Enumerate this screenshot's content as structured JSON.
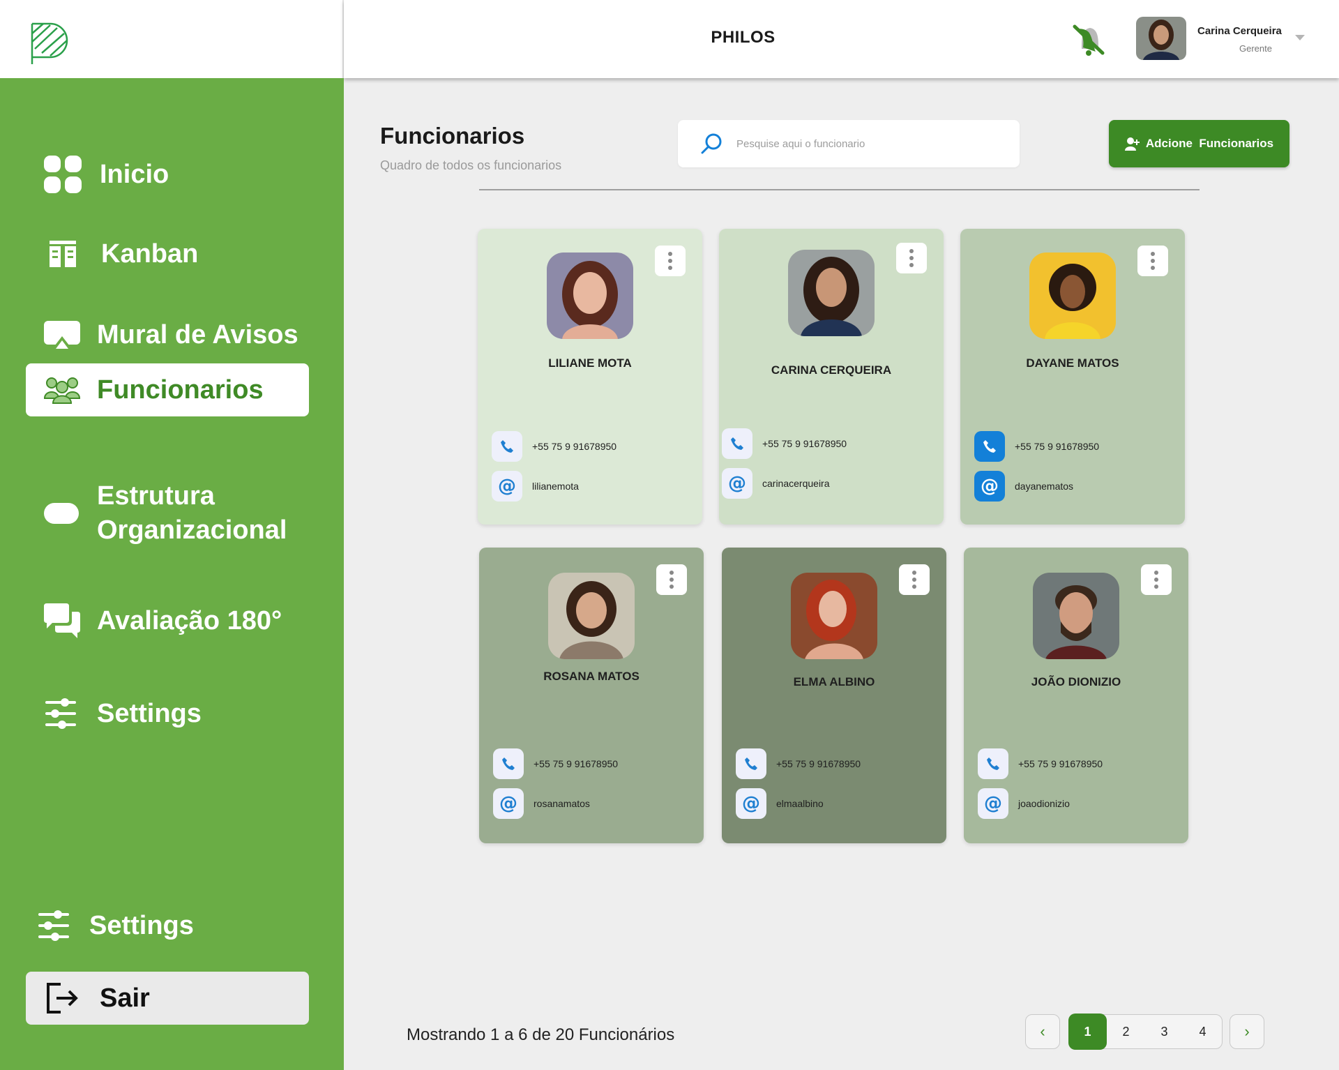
{
  "header": {
    "app_title": "PHILOS",
    "user": {
      "name": "Carina Cerqueira",
      "role": "Gerente"
    }
  },
  "sidebar": {
    "items": [
      {
        "label": "Inicio",
        "icon": "grid-icon"
      },
      {
        "label": "Kanban",
        "icon": "kanban-icon"
      },
      {
        "label": "Mural de Avisos",
        "icon": "notice-board-icon"
      },
      {
        "label": "Funcionarios",
        "icon": "users-icon",
        "active": true
      },
      {
        "label": "Estrutura Organizacional",
        "icon": "pill-icon"
      },
      {
        "label": "Avaliação 180°",
        "icon": "chat-bubbles-icon"
      },
      {
        "label": "Settings",
        "icon": "sliders-icon"
      }
    ],
    "bottom": {
      "settings_label": "Settings",
      "logout_label": "Sair"
    }
  },
  "page": {
    "title": "Funcionarios",
    "subtitle": "Quadro de todos os funcionarios",
    "search_placeholder": "Pesquise aqui o funcionario",
    "add_button": "Adcione  Funcionarios"
  },
  "employees": [
    {
      "name": "LILIANE MOTA",
      "phone": "+55 75 9 91678950",
      "username": "lilianemota",
      "bg": "#dce9d6"
    },
    {
      "name": "CARINA CERQUEIRA",
      "phone": "+55 75 9 91678950",
      "username": "carinacerqueira",
      "bg": "#cfdfc7"
    },
    {
      "name": "DAYANE MATOS",
      "phone": "+55 75 9 91678950",
      "username": "dayanematos",
      "bg": "#b9cbb0"
    },
    {
      "name": "ROSANA MATOS",
      "phone": "+55 75 9 91678950",
      "username": "rosanamatos",
      "bg": "#9aac90"
    },
    {
      "name": "ELMA ALBINO",
      "phone": "+55 75 9 91678950",
      "username": "elmaalbino",
      "bg": "#7b8b71"
    },
    {
      "name": "JOÃO DIONIZIO",
      "phone": "+55 75 9 91678950",
      "username": "joaodionizio",
      "bg": "#a6b99c"
    }
  ],
  "footer": {
    "showing": "Mostrando 1 a 6 de 20 Funcionários",
    "pages": [
      "1",
      "2",
      "3",
      "4"
    ],
    "current_page": "1"
  },
  "colors": {
    "sidebar": "#6aad45",
    "accent": "#3d8a25"
  }
}
